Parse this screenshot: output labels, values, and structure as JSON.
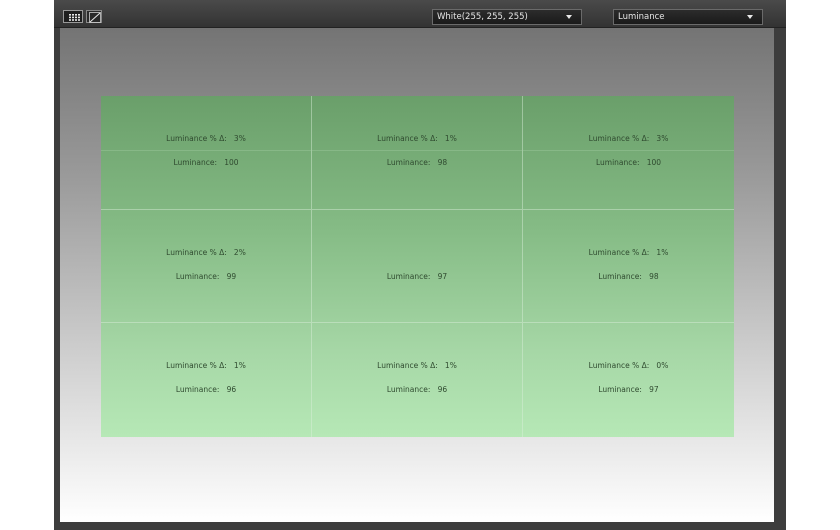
{
  "toolbar": {
    "color_select": {
      "value": "White(255, 255, 255)"
    },
    "mode_select": {
      "value": "Luminance"
    }
  },
  "icons": {
    "grid_view": "grid-icon",
    "curve_view": "curve-icon",
    "dropdown": "chevron-down-icon"
  },
  "colors": {
    "toolbar_bg": "#3d3d3d",
    "panel_top": "#6a9f6a",
    "panel_bottom": "#b6e8b6",
    "cell_text": "#2f4a2f"
  },
  "grid": {
    "delta_label": "Luminance % Δ:",
    "value_label": "Luminance:",
    "cells": [
      {
        "delta": "3%",
        "luminance": "100"
      },
      {
        "delta": "1%",
        "luminance": "98"
      },
      {
        "delta": "3%",
        "luminance": "100"
      },
      {
        "delta": "2%",
        "luminance": "99"
      },
      {
        "delta": "",
        "luminance": "97"
      },
      {
        "delta": "1%",
        "luminance": "98"
      },
      {
        "delta": "1%",
        "luminance": "96"
      },
      {
        "delta": "1%",
        "luminance": "96"
      },
      {
        "delta": "0%",
        "luminance": "97"
      }
    ]
  }
}
